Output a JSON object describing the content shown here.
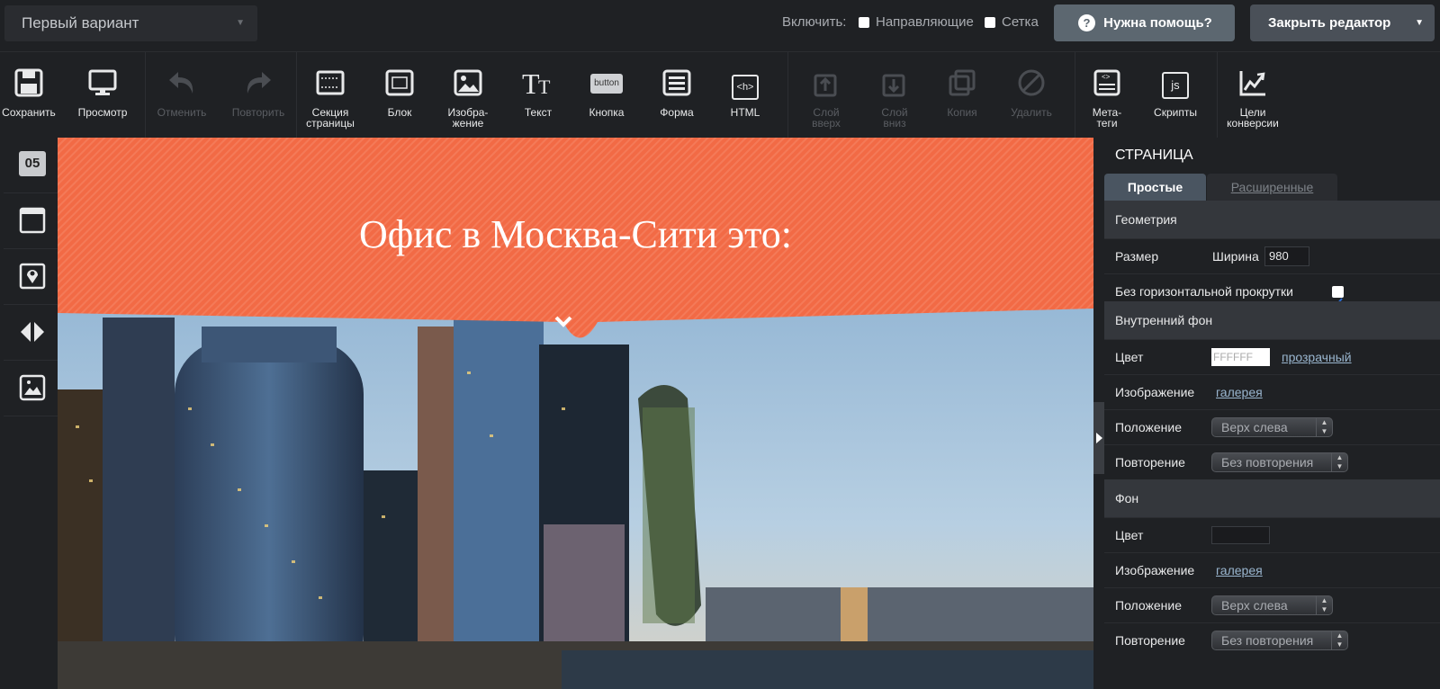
{
  "topbar": {
    "variant": "Первый вариант",
    "enable_label": "Включить:",
    "guides_label": "Направляющие",
    "grid_label": "Сетка",
    "help_label": "Нужна помощь?",
    "close_label": "Закрыть редактор"
  },
  "toolbar": {
    "save": "Сохранить",
    "preview": "Просмотр",
    "undo": "Отменить",
    "redo": "Повторить",
    "section": "Секция\nстраницы",
    "block": "Блок",
    "image": "Изобра-\nжение",
    "text": "Текст",
    "button": "Кнопка",
    "button_icon_text": "button",
    "form": "Форма",
    "html": "HTML",
    "html_icon_text": "<h>",
    "layer_up": "Слой\nвверх",
    "layer_down": "Слой\nвниз",
    "copy": "Копия",
    "delete": "Удалить",
    "meta": "Мета-\nтеги",
    "scripts": "Скрипты",
    "scripts_icon_text": "js",
    "goals": "Цели\nконверсии"
  },
  "leftbar": {
    "timer_text": "05"
  },
  "canvas": {
    "banner_title": "Офис в Москва-Сити это:",
    "banner_color": "#f26a45"
  },
  "panel": {
    "title": "СТРАНИЦА",
    "tab_simple": "Простые",
    "tab_advanced": "Расширенные",
    "geometry": {
      "header": "Геометрия",
      "size_label": "Размер",
      "width_label": "Ширина",
      "width_value": "980",
      "no_hscroll_label": "Без горизонтальной прокрутки",
      "no_hscroll_checked": true
    },
    "inner_bg": {
      "header": "Внутренний фон",
      "color_label": "Цвет",
      "color_value": "FFFFFF",
      "transparent_link": "прозрачный",
      "image_label": "Изображение",
      "gallery_link": "галерея",
      "position_label": "Положение",
      "position_value": "Верх слева",
      "repeat_label": "Повторение",
      "repeat_value": "Без повторения"
    },
    "bg": {
      "header": "Фон",
      "color_label": "Цвет",
      "color_value": "",
      "image_label": "Изображение",
      "gallery_link": "галерея",
      "position_label": "Положение",
      "position_value": "Верх слева",
      "repeat_label": "Повторение",
      "repeat_value": "Без повторения"
    }
  }
}
